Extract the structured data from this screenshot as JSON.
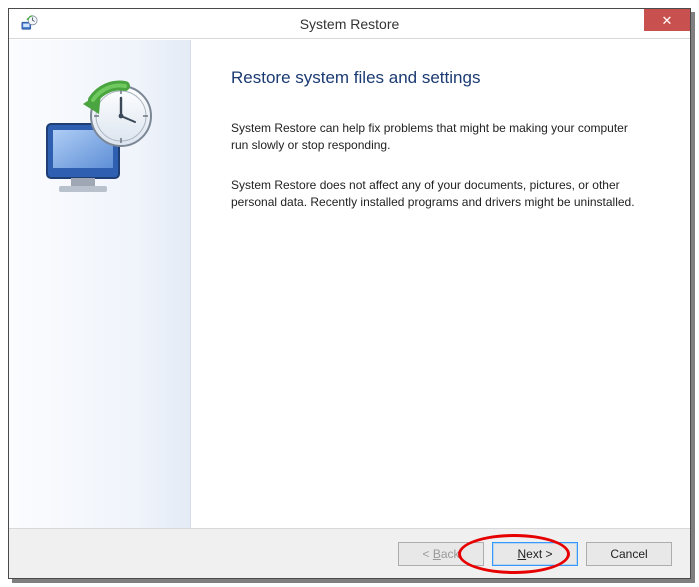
{
  "titlebar": {
    "title": "System Restore",
    "icon_name": "system-restore-icon"
  },
  "close_button": {
    "glyph": "✕"
  },
  "content": {
    "heading": "Restore system files and settings",
    "paragraph1": "System Restore can help fix problems that might be making your computer run slowly or stop responding.",
    "paragraph2": "System Restore does not affect any of your documents, pictures, or other personal data. Recently installed programs and drivers might be uninstalled."
  },
  "buttons": {
    "back": {
      "prefix": "< ",
      "mnemonic": "B",
      "rest": "ack"
    },
    "next": {
      "mnemonic": "N",
      "rest": "ext >"
    },
    "cancel": {
      "label": "Cancel"
    }
  }
}
